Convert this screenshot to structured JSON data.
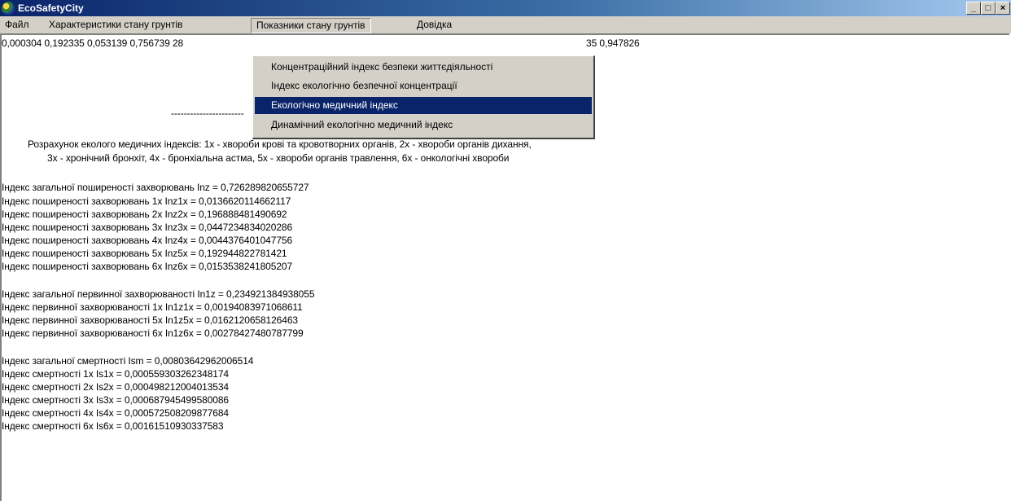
{
  "window": {
    "title": "EcoSafetyCity",
    "minimize": "_",
    "maximize": "□",
    "close": "×"
  },
  "menu": {
    "file": "Файл",
    "soil_characteristics": "Характеристики стану грунтів",
    "soil_indicators": "Показники стану грунтів",
    "help": "Довідка"
  },
  "dropdown": {
    "items": [
      "Концентраційний індекс безпеки життєдіяльності",
      "Індекс екологічно безпечної концентрації",
      "Екологічно медичний індекс",
      "Динамічний екологічно медичний індекс"
    ],
    "selected_index": 2
  },
  "content": {
    "values_line_left": "0,000304 0,192335 0,053139 0,756739 28",
    "values_line_right": "35 0,947826",
    "dashes": "-----------------------",
    "desc_line1": "Розрахунок еколого медичних індексів: 1х - хвороби крові та кровотворних органів, 2х - хвороби органів дихання,",
    "desc_line2": "3х - хронічний бронхіт, 4х - бронхіальна астма, 5х - хвороби органів травлення, 6х - онкологічні хвороби",
    "group1": [
      "Індекс загальної поширеності захворювань Inz = 0,726289820655727",
      "Індекс поширеності захворювань 1х Inz1х = 0,0136620114662117",
      "Індекс поширеності захворювань 2х Inz2х = 0,196888481490692",
      "Індекс поширеності захворювань 3х Inz3х = 0,0447234834020286",
      "Індекс поширеності захворювань 4х Inz4х = 0,0044376401047756",
      "Індекс поширеності захворювань 5х Inz5х = 0,192944822781421",
      "Індекс поширеності захворювань 6х Inz6х = 0,0153538241805207"
    ],
    "group2": [
      "Індекс загальної первинної захворюваності In1z = 0,234921384938055",
      "Індекс первинної захворюваності 1х In1z1х = 0,00194083971068611",
      "Індекс первинної захворюваності 5х In1z5х = 0,0162120658126463",
      "Індекс первинної захворюваності 6х In1z6х = 0,00278427480787799"
    ],
    "group3": [
      "Індекс загальної смертності Ism = 0,00803642962006514",
      "Індекс смертності 1х Is1х = 0,000559303262348174",
      "Індекс смертності 2х Is2х = 0,000498212004013534",
      "Індекс смертності 3х Is3х = 0,000687945499580086",
      "Індекс смертності 4х Is4х = 0,000572508209877684",
      "Індекс смертності 6х Is6х = 0,00161510930337583"
    ]
  }
}
